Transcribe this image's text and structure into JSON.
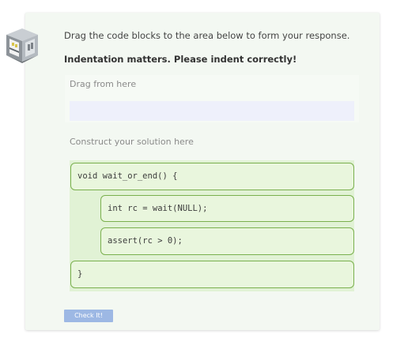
{
  "instructions": "Drag the code blocks to the area below to form your response.",
  "indent_note": "Indentation matters. Please indent correctly!",
  "source_area": {
    "label": "Drag from here"
  },
  "target_area": {
    "label": "Construct your solution here",
    "blocks": [
      {
        "code": "void wait_or_end() {",
        "indent": 0
      },
      {
        "code": "int rc = wait(NULL);",
        "indent": 1
      },
      {
        "code": "assert(rc > 0);",
        "indent": 1
      },
      {
        "code": "}",
        "indent": 0
      }
    ]
  },
  "check_button": {
    "label": "Check It!"
  },
  "colors": {
    "block_border": "#7ab04e",
    "block_fill": "#e9f6dd",
    "target_fill": "#e1f2d5",
    "drop_fill": "#eef0fb",
    "button_fill": "#9db8e4"
  },
  "icons": {
    "logo": "building-logo-icon"
  }
}
